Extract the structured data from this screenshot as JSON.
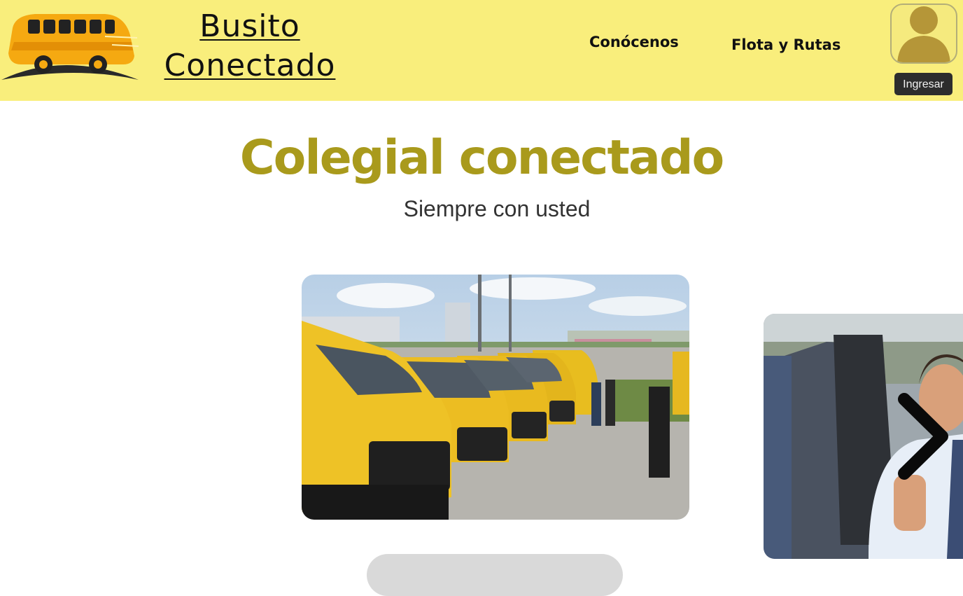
{
  "header": {
    "brand_line1": "Busito",
    "brand_line2": "Conectado",
    "nav": [
      {
        "label": "Conócenos"
      },
      {
        "label": "Flota y Rutas"
      }
    ],
    "login_label": "Ingresar",
    "background_color": "#f9ee7c"
  },
  "hero": {
    "title": "Colegial conectado",
    "subtitle": "Siempre con usted",
    "title_color": "#a99a1c"
  },
  "carousel": {
    "slides": [
      {
        "subject": "row of yellow school vans"
      },
      {
        "subject": "smiling driver giving thumbs up"
      }
    ],
    "next_icon": "chevron-right-icon"
  }
}
